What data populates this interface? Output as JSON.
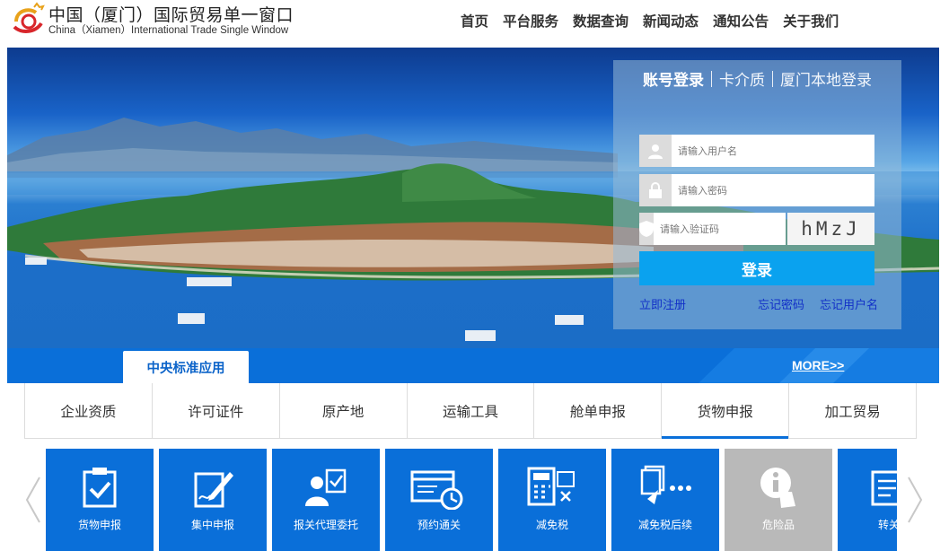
{
  "header": {
    "title": "中国（厦门）国际贸易单一窗口",
    "subtitle": "China（Xiamen）International Trade Single  Window",
    "nav": [
      "首页",
      "平台服务",
      "数据查询",
      "新闻动态",
      "通知公告",
      "关于我们"
    ]
  },
  "login": {
    "tabs": [
      "账号登录",
      "卡介质",
      "厦门本地登录"
    ],
    "username_placeholder": "请输入用户名",
    "password_placeholder": "请输入密码",
    "captcha_placeholder": "请输入验证码",
    "captcha_text": "hMzJ",
    "submit_label": "登录",
    "register_link": "立即注册",
    "forgot_password_link": "忘记密码",
    "forgot_username_link": "忘记用户名"
  },
  "section": {
    "tab_label": "中央标准应用",
    "more_label": "MORE>>"
  },
  "categories": [
    "企业资质",
    "许可证件",
    "原产地",
    "运输工具",
    "舱单申报",
    "货物申报",
    "加工贸易"
  ],
  "active_category": "货物申报",
  "tiles": [
    {
      "label": "货物申报",
      "icon": "clipboard-check-icon"
    },
    {
      "label": "集中申报",
      "icon": "pen-document-icon"
    },
    {
      "label": "报关代理委托",
      "icon": "agent-document-icon"
    },
    {
      "label": "预约通关",
      "icon": "browser-clock-icon"
    },
    {
      "label": "减免税",
      "icon": "calculator-icon"
    },
    {
      "label": "减免税后续",
      "icon": "documents-dots-icon"
    },
    {
      "label": "危险品",
      "icon": "info-hand-icon"
    },
    {
      "label": "转关",
      "icon": "document-stack-icon"
    }
  ],
  "colors": {
    "primary": "#0a6fd9",
    "login_button": "#0aa2ef",
    "link": "#1230c8",
    "tile_disabled": "#b9b9b9"
  }
}
